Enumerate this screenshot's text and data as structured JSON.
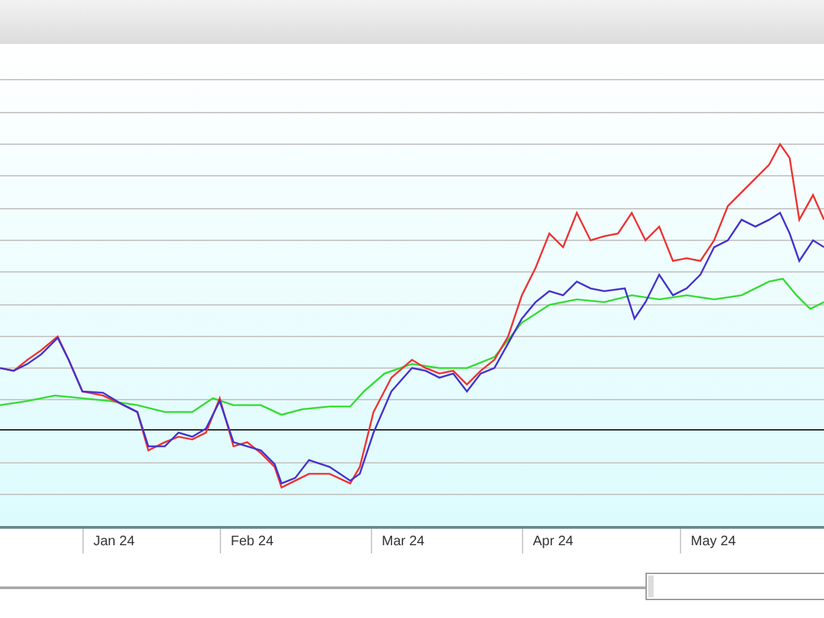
{
  "x_axis": {
    "labels": [
      "Jan 24",
      "Feb 24",
      "Mar 24",
      "Apr 24",
      "May 24"
    ]
  }
}
